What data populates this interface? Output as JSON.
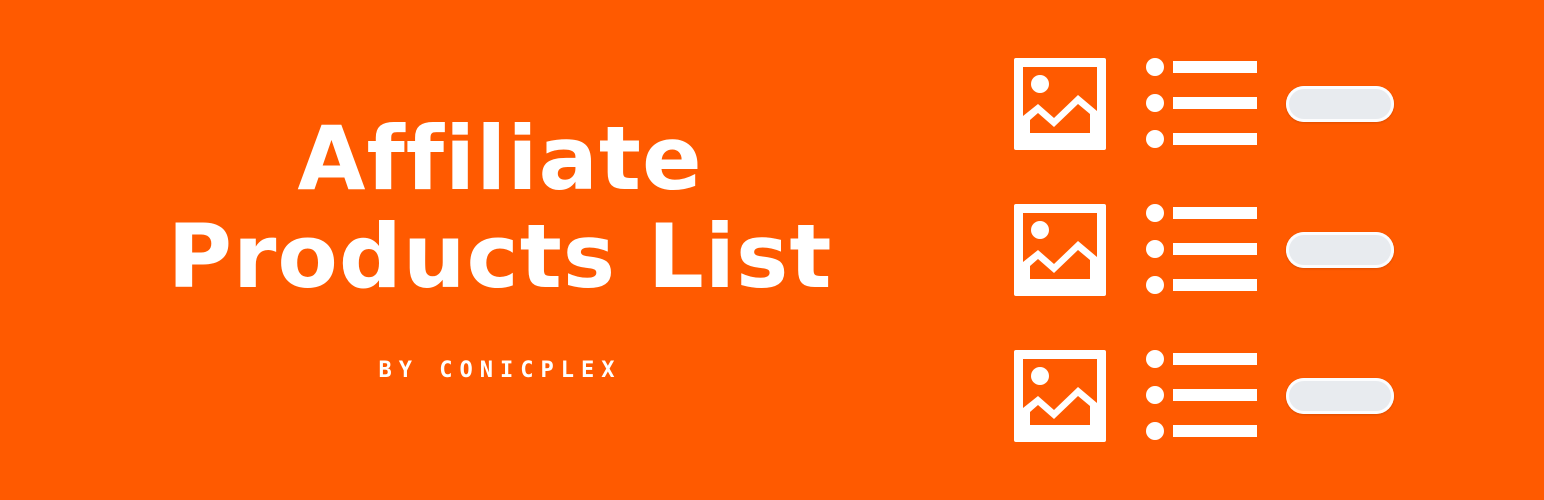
{
  "colors": {
    "background": "#FF5A00",
    "foreground": "#FFFFFF",
    "button_fill": "#E8EBEF"
  },
  "title": {
    "line1": "Affiliate",
    "line2": "Products List"
  },
  "byline": "BY CONICPLEX",
  "product_list": {
    "rows": [
      {
        "image_icon": "image-placeholder-icon",
        "bullet_count": 3,
        "button": "pill-button"
      },
      {
        "image_icon": "image-placeholder-icon",
        "bullet_count": 3,
        "button": "pill-button"
      },
      {
        "image_icon": "image-placeholder-icon",
        "bullet_count": 3,
        "button": "pill-button"
      }
    ]
  }
}
